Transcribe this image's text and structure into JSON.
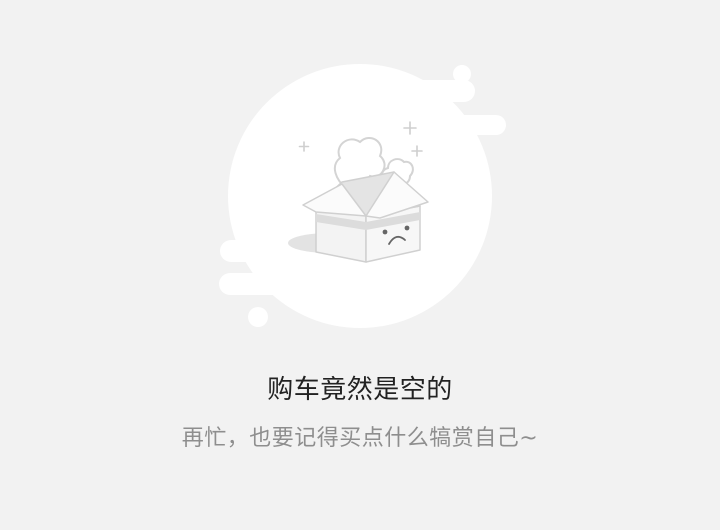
{
  "empty_state": {
    "title": "购车竟然是空的",
    "subtitle": "再忙，也要记得买点什么犒赏自己~",
    "illustration_icon": "empty-cart-box-icon"
  },
  "colors": {
    "background": "#f2f2f2",
    "illustration_fill": "#ffffff",
    "title_text": "#222222",
    "subtitle_text": "#8e8e8e"
  }
}
